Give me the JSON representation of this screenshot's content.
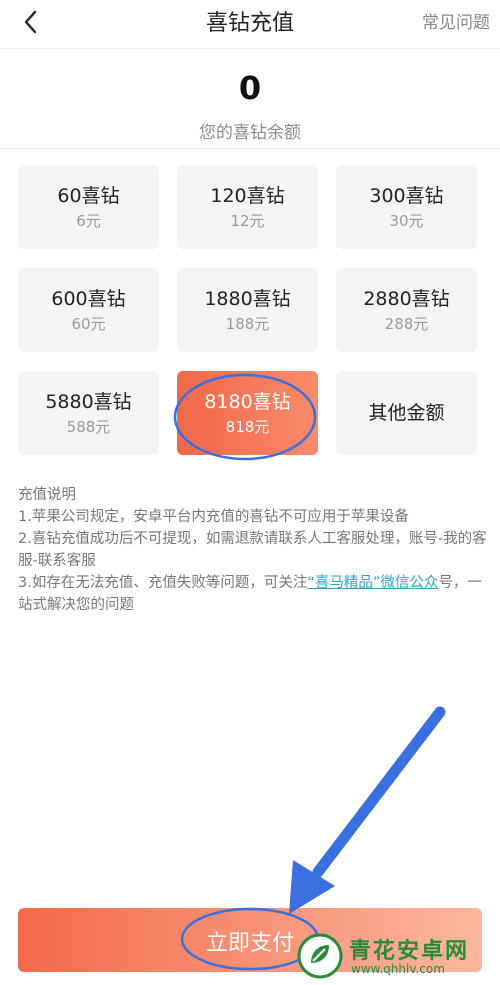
{
  "header": {
    "title": "喜钻充值",
    "faq_label": "常见问题"
  },
  "balance": {
    "value": "0",
    "label": "您的喜钻余额"
  },
  "packages": [
    {
      "amount": "60喜钻",
      "price": "6元",
      "selected": false
    },
    {
      "amount": "120喜钻",
      "price": "12元",
      "selected": false
    },
    {
      "amount": "300喜钻",
      "price": "30元",
      "selected": false
    },
    {
      "amount": "600喜钻",
      "price": "60元",
      "selected": false
    },
    {
      "amount": "1880喜钻",
      "price": "188元",
      "selected": false
    },
    {
      "amount": "2880喜钻",
      "price": "288元",
      "selected": false
    },
    {
      "amount": "5880喜钻",
      "price": "588元",
      "selected": false
    },
    {
      "amount": "8180喜钻",
      "price": "818元",
      "selected": true
    },
    {
      "amount": "其他金额",
      "price": "",
      "selected": false
    }
  ],
  "notes": {
    "title": "充值说明",
    "line1": "1.苹果公司规定，安卓平台内充值的喜钻不可应用于苹果设备",
    "line2": "2.喜钻充值成功后不可提现，如需退款请联系人工客服处理，账号-我的客服-联系客服",
    "line3_prefix": "3.如存在无法充值、充值失败等问题，可关注",
    "line3_link": "“喜马精品”微信公众",
    "line3_suffix": "号，一站式解决您的问题"
  },
  "pay_button": {
    "label": "立即支付"
  },
  "colors": {
    "accent": "#f0684a",
    "annotation": "#3a6fe0",
    "link": "#2aa6c9"
  },
  "watermark": {
    "name": "青花安卓网",
    "url": "www.qhhlv.com"
  }
}
